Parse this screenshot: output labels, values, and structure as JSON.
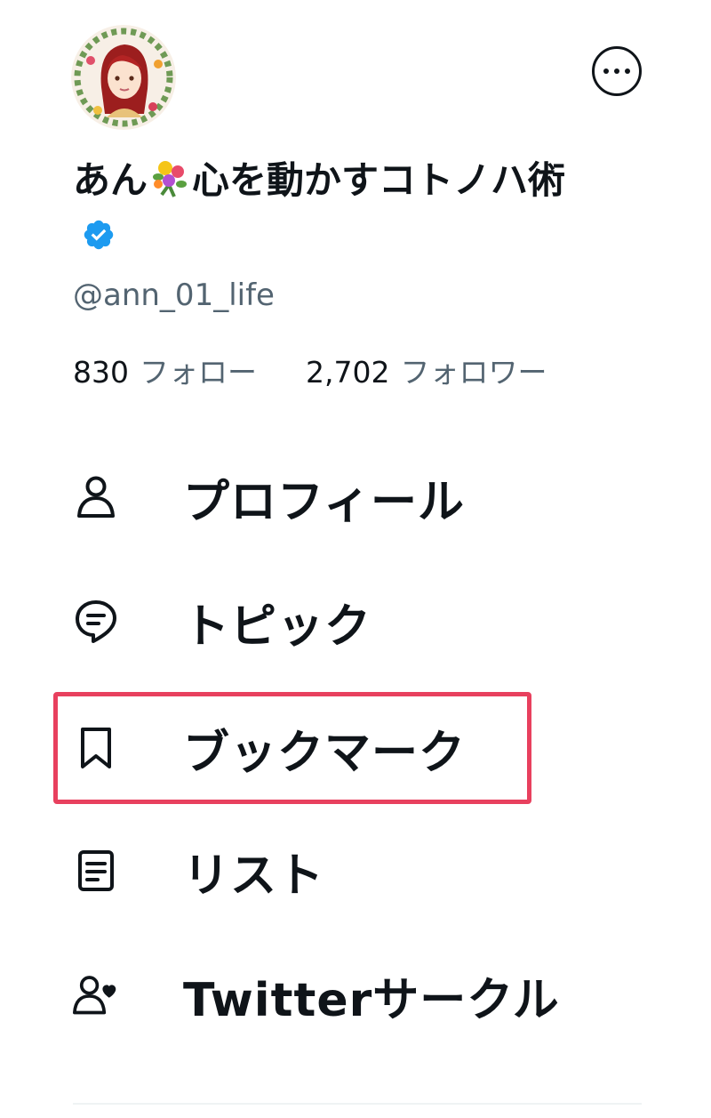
{
  "profile": {
    "name_part1": "あん",
    "name_part2": "心を動かすコトノハ術",
    "handle": "@ann_01_life",
    "following_count": "830",
    "following_label": "フォロー",
    "followers_count": "2,702",
    "followers_label": "フォロワー"
  },
  "menu": {
    "items": [
      {
        "label": "プロフィール",
        "icon": "person-icon"
      },
      {
        "label": "トピック",
        "icon": "topics-icon"
      },
      {
        "label": "ブックマーク",
        "icon": "bookmark-icon",
        "highlighted": true
      },
      {
        "label": "リスト",
        "icon": "list-icon"
      },
      {
        "label": "Twitterサークル",
        "icon": "twitter-circle-icon"
      }
    ]
  },
  "colors": {
    "text": "#0f1419",
    "secondary": "#536471",
    "verified": "#1d9bf0",
    "highlight": "#e8405e"
  }
}
